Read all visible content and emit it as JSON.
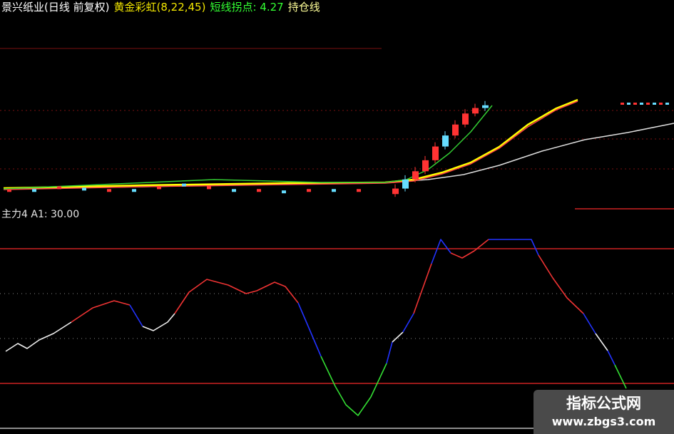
{
  "header": {
    "stock_title": "景兴纸业(日线 前复权)",
    "indicator_name": "黄金彩虹(8,22,45)",
    "pivot_label": "短线拐点: 4.27",
    "position_label": "持仓线"
  },
  "sub_indicator": {
    "label": "主力4",
    "a1_label": "A1: 30.00"
  },
  "watermark": {
    "title": "指标公式网",
    "url": "www.zbgs3.com"
  },
  "colors": {
    "background": "#000000",
    "hdr_white": "#ffffff",
    "hdr_yellow": "#f2e600",
    "hdr_green": "#33ff33",
    "hdr_lightyellow": "#ffff99",
    "up_candle": "#ff3333",
    "down_candle": "#66ddff",
    "ma_yellow": "#ffff00",
    "ma_red": "#ff4444",
    "ma_green": "#33cc33",
    "ma_white": "#dddddd",
    "osc_white": "#eeeeee",
    "osc_red": "#ee3333",
    "osc_blue": "#2233ff",
    "osc_green": "#33dd33",
    "level_red": "#cc2222",
    "level_dot": "#888888"
  },
  "candle_values": {
    "flat_section": [
      4.2,
      4.2,
      4.3,
      4.25,
      4.2,
      4.2,
      4.3,
      4.4,
      4.3,
      4.2,
      4.2,
      4.15,
      4.2,
      4.2,
      4.2
    ],
    "rally": [
      4.27,
      4.6,
      4.9,
      5.3,
      5.8,
      6.2,
      6.6,
      7.0,
      7.2,
      7.3
    ]
  },
  "oscillator": {
    "ylim": [
      0,
      100
    ],
    "levels": [
      80,
      20
    ],
    "dotted_levels": [
      60,
      40
    ]
  }
}
